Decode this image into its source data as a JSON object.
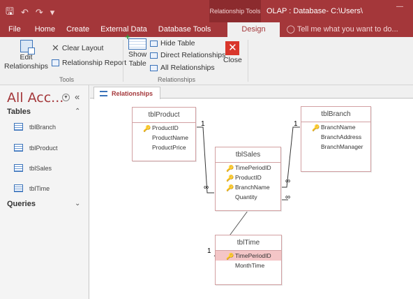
{
  "titlebar": {
    "context_tab_group": "Relationship Tools",
    "window_title": "OLAP : Database- C:\\Users\\"
  },
  "tabs": {
    "file": "File",
    "home": "Home",
    "create": "Create",
    "external_data": "External Data",
    "database_tools": "Database Tools",
    "design": "Design",
    "tell_me": "Tell me what you want to do..."
  },
  "ribbon": {
    "edit_relationships_line1": "Edit",
    "edit_relationships_line2": "Relationships",
    "clear_layout": "Clear Layout",
    "relationship_report": "Relationship Report",
    "tools_group": "Tools",
    "show_table_line1": "Show",
    "show_table_line2": "Table",
    "hide_table": "Hide Table",
    "direct_relationships": "Direct Relationships",
    "all_relationships": "All Relationships",
    "close": "Close",
    "relationships_group": "Relationships"
  },
  "nav": {
    "title": "All Acc...",
    "tables_label": "Tables",
    "queries_label": "Queries",
    "tables": [
      "tblBranch",
      "tblProduct",
      "tblSales",
      "tblTime"
    ]
  },
  "document": {
    "tab_label": "Relationships"
  },
  "diagram": {
    "one_symbol": "1",
    "many_symbol": "∞",
    "tables": {
      "product": {
        "name": "tblProduct",
        "fields": [
          {
            "name": "ProductID",
            "pk": true
          },
          {
            "name": "ProductName",
            "pk": false
          },
          {
            "name": "ProductPrice",
            "pk": false
          }
        ]
      },
      "branch": {
        "name": "tblBranch",
        "fields": [
          {
            "name": "BranchName",
            "pk": true
          },
          {
            "name": "BranchAddress",
            "pk": false
          },
          {
            "name": "BranchManager",
            "pk": false
          }
        ]
      },
      "sales": {
        "name": "tblSales",
        "fields": [
          {
            "name": "TimePeriodID",
            "pk": true
          },
          {
            "name": "ProductID",
            "pk": true
          },
          {
            "name": "BranchName",
            "pk": true
          },
          {
            "name": "Quantity",
            "pk": false
          }
        ]
      },
      "time": {
        "name": "tblTime",
        "fields": [
          {
            "name": "TimePeriodID",
            "pk": true,
            "selected": true
          },
          {
            "name": "MonthTime",
            "pk": false
          }
        ]
      }
    }
  },
  "colors": {
    "accent": "#a4373a",
    "selected_field": "#f4c6c7"
  }
}
